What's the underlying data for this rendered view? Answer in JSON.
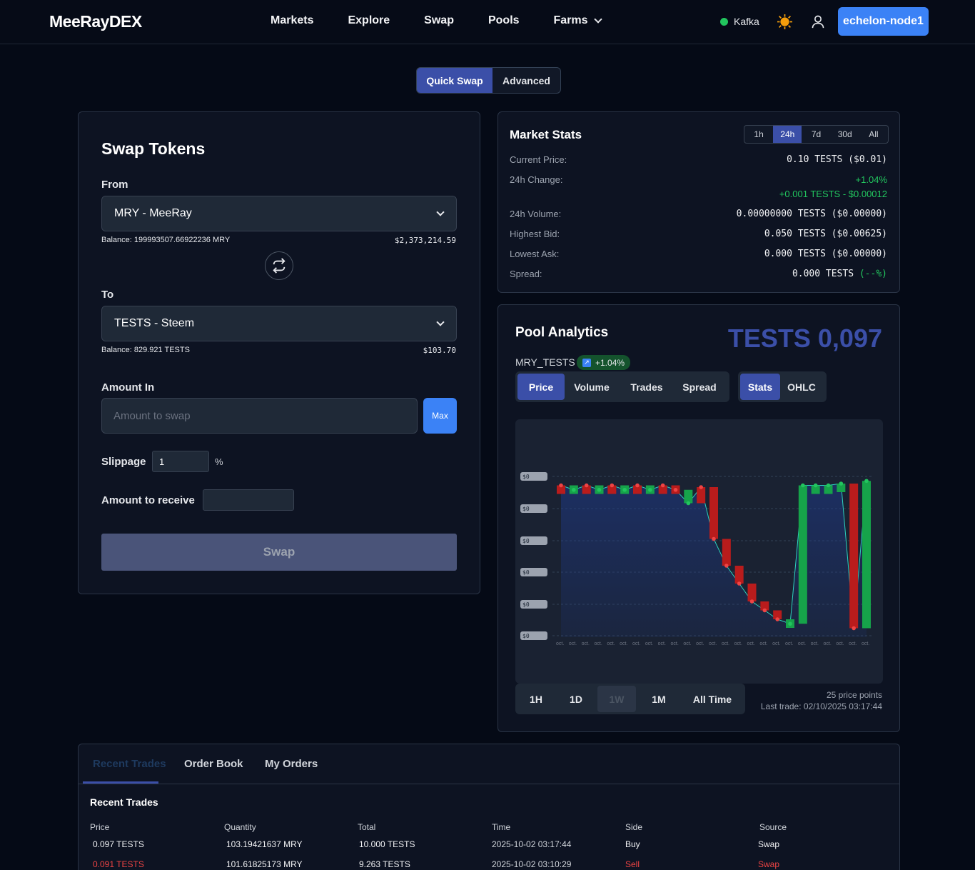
{
  "header": {
    "logo": "MeeRayDEX",
    "nav": [
      "Markets",
      "Explore",
      "Swap",
      "Pools",
      "Farms"
    ],
    "status_label": "Kafka",
    "node_button": "echelon-node1"
  },
  "mode_toggle": {
    "quick": "Quick Swap",
    "advanced": "Advanced"
  },
  "swap": {
    "title": "Swap Tokens",
    "from_label": "From",
    "from_token": "MRY - MeeRay",
    "from_balance": "Balance: 199993507.66922236 MRY",
    "from_usd": "$2,373,214.59",
    "to_label": "To",
    "to_token": "TESTS - Steem",
    "to_balance": "Balance: 829.921 TESTS",
    "to_usd": "$103.70",
    "amount_in_label": "Amount In",
    "amount_placeholder": "Amount to swap",
    "max_label": "Max",
    "slippage_label": "Slippage",
    "slippage_value": "1",
    "slippage_unit": "%",
    "receive_label": "Amount to receive",
    "swap_button": "Swap"
  },
  "market_stats": {
    "title": "Market Stats",
    "timeframes": [
      "1h",
      "24h",
      "7d",
      "30d",
      "All"
    ],
    "active_timeframe": "24h",
    "rows": {
      "current_price_label": "Current Price:",
      "current_price": "0.10 TESTS ($0.01)",
      "change_label": "24h Change:",
      "change_pct": "+1.04%",
      "change_abs": "+0.001 TESTS - $0.00012",
      "volume_label": "24h Volume:",
      "volume": "0.00000000 TESTS ($0.00000)",
      "bid_label": "Highest Bid:",
      "bid": "0.050 TESTS ($0.00625)",
      "ask_label": "Lowest Ask:",
      "ask": "0.000 TESTS ($0.00000)",
      "spread_label": "Spread:",
      "spread_value": "0.000 TESTS",
      "spread_pct": "(--%)"
    }
  },
  "pool": {
    "title": "Pool Analytics",
    "big_price": "TESTS 0,097",
    "pair": "MRY_TESTS",
    "change_badge": "+1.04%",
    "tabs": [
      "Price",
      "Volume",
      "Trades",
      "Spread"
    ],
    "view_tabs": [
      "Stats",
      "OHLC"
    ],
    "ranges": [
      "1H",
      "1D",
      "1W",
      "1M",
      "All Time"
    ],
    "price_points": "25 price points",
    "last_trade": "Last trade: 02/10/2025 03:17:44",
    "y_tick_label": "$0",
    "x_tick_label": "oct."
  },
  "chart_data": {
    "type": "line",
    "title": "",
    "series": [
      {
        "values": [
          0.097,
          0.0965,
          0.097,
          0.0965,
          0.097,
          0.0965,
          0.097,
          0.0965,
          0.097,
          0.0965,
          0.095,
          0.0968,
          0.091,
          0.088,
          0.086,
          0.084,
          0.083,
          0.082,
          0.0815,
          0.097,
          0.097,
          0.097,
          0.0972,
          0.081,
          0.0975
        ]
      }
    ],
    "candles": [
      {
        "dir": "down"
      },
      {
        "dir": "up"
      },
      {
        "dir": "down"
      },
      {
        "dir": "up"
      },
      {
        "dir": "down"
      },
      {
        "dir": "up"
      },
      {
        "dir": "down"
      },
      {
        "dir": "up"
      },
      {
        "dir": "down"
      },
      {
        "dir": "down"
      },
      {
        "dir": "up"
      },
      {
        "dir": "down"
      },
      {
        "dir": "down"
      },
      {
        "dir": "down"
      },
      {
        "dir": "down"
      },
      {
        "dir": "down"
      },
      {
        "dir": "down"
      },
      {
        "dir": "down"
      },
      {
        "dir": "up"
      },
      {
        "dir": "up"
      },
      {
        "dir": "up"
      },
      {
        "dir": "up"
      },
      {
        "dir": "up"
      },
      {
        "dir": "down"
      },
      {
        "dir": "up"
      }
    ],
    "ylim": [
      0.08,
      0.098
    ],
    "grid": true,
    "colors": {
      "up": "#16a34a",
      "down": "#b91c1c",
      "area": "#1e3a8a"
    }
  },
  "bottom": {
    "tabs": [
      "Recent Trades",
      "Order Book",
      "My Orders"
    ],
    "section_title": "Recent Trades",
    "columns": [
      "Price",
      "Quantity",
      "Total",
      "Time",
      "Side",
      "Source"
    ],
    "rows": [
      {
        "price": "0.097 TESTS",
        "quantity": "103.19421637 MRY",
        "total": "10.000 TESTS",
        "time": "2025-10-02 03:17:44",
        "side": "Buy",
        "source": "Swap"
      },
      {
        "price": "0.091 TESTS",
        "quantity": "101.61825173 MRY",
        "total": "9.263 TESTS",
        "time": "2025-10-02 03:10:29",
        "side": "Sell",
        "source": "Swap"
      }
    ]
  },
  "colors": {
    "accent": "#3b82f6",
    "active_tab": "#3b4fa8",
    "up": "#22c55e",
    "down": "#ef4444"
  }
}
